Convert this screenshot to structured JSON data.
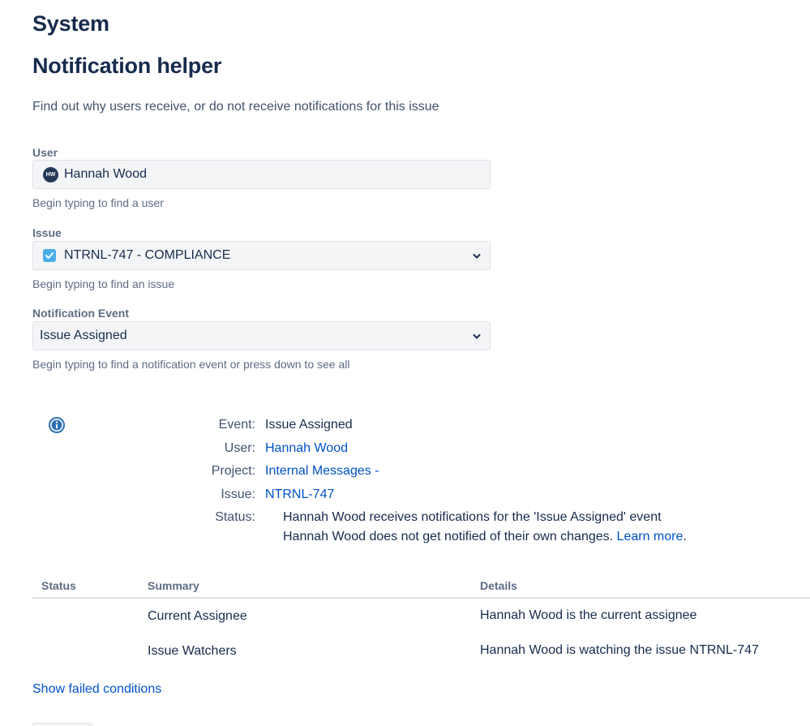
{
  "header": {
    "section": "System",
    "title": "Notification helper",
    "description": "Find out why users receive, or do not receive notifications for this issue"
  },
  "form": {
    "user": {
      "label": "User",
      "value": "Hannah Wood",
      "avatar_initials": "HW",
      "help": "Begin typing to find a user"
    },
    "issue": {
      "label": "Issue",
      "value": "NTRNL-747 - COMPLIANCE",
      "icon": "checkbox-task-icon",
      "help": "Begin typing to find an issue"
    },
    "event": {
      "label": "Notification Event",
      "value": "Issue Assigned",
      "help": "Begin typing to find a notification event or press down to see all"
    }
  },
  "details": {
    "event_key": "Event:",
    "event_val": "Issue Assigned",
    "user_key": "User:",
    "user_val": "Hannah Wood",
    "project_key": "Project:",
    "project_val": "Internal Messages -",
    "issue_key": "Issue:",
    "issue_val": "NTRNL-747",
    "status_key": "Status:",
    "status_line1": "Hannah Wood receives notifications for the 'Issue Assigned' event",
    "status_line2": "Hannah Wood does not get notified of their own changes.",
    "learn_more": "Learn more",
    "period": "."
  },
  "table": {
    "headers": [
      "Status",
      "Summary",
      "Details"
    ],
    "rows": [
      {
        "summary": "Current Assignee",
        "details": "Hannah Wood is the current assignee"
      },
      {
        "summary": "Issue Watchers",
        "details": "Hannah Wood is watching the issue NTRNL-747"
      }
    ]
  },
  "show_failed": "Show failed conditions",
  "colors": {
    "text": "#172b4d",
    "subtle": "#5e6c84",
    "link": "#0052cc",
    "info": "#2d6fb4",
    "issue_icon": "#4bade8"
  }
}
